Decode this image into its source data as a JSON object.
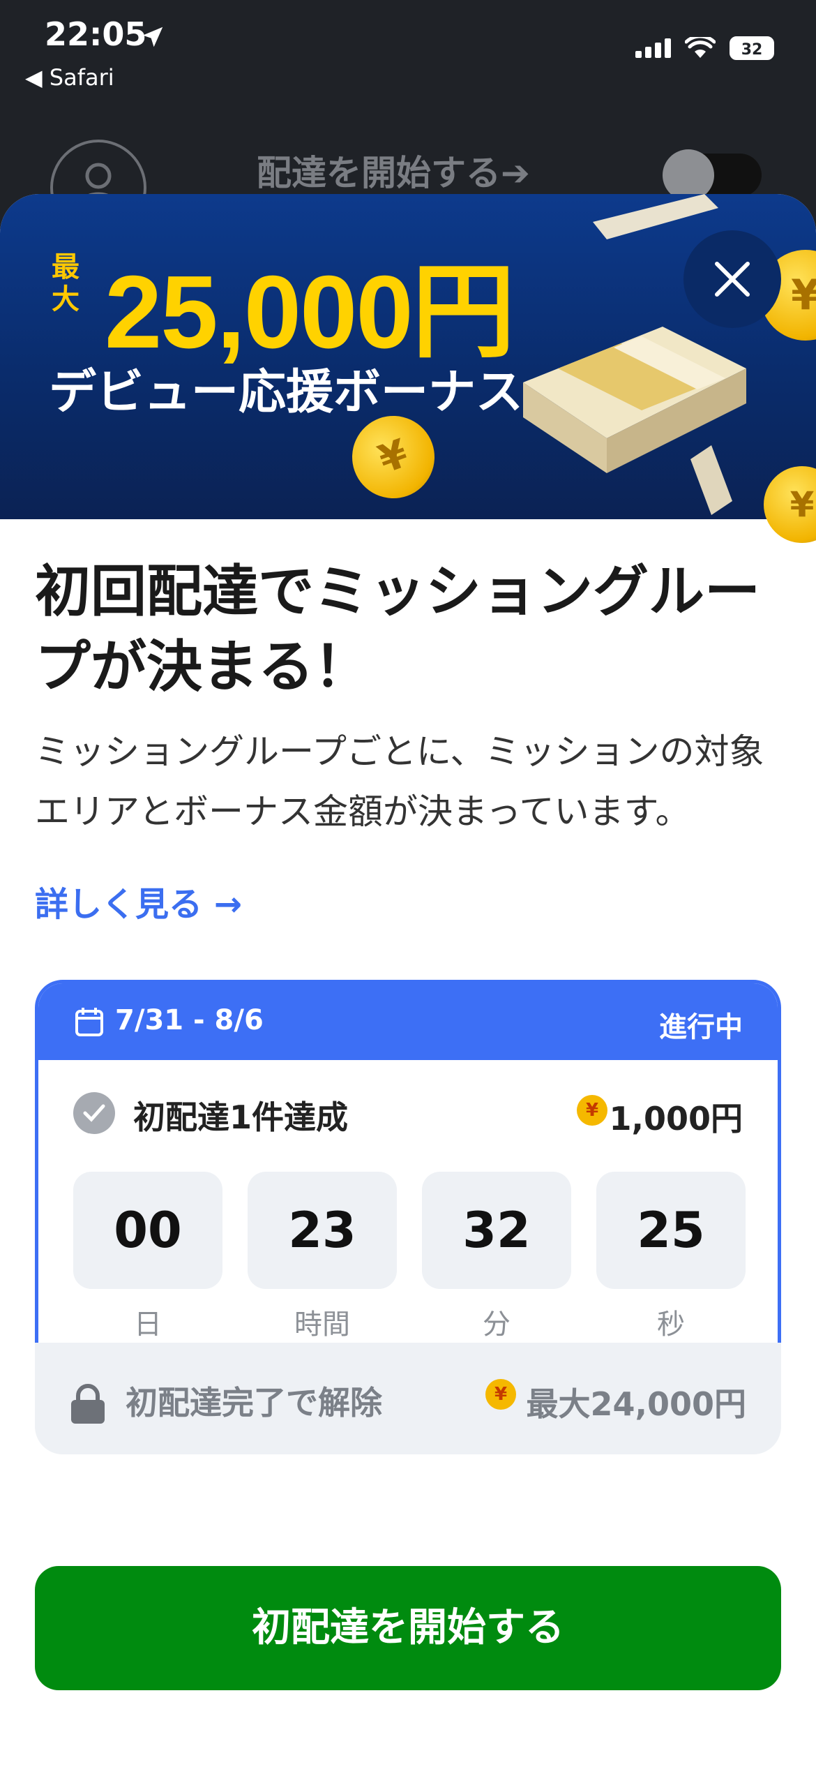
{
  "status_bar": {
    "time": "22:05",
    "back_label": "◀ Safari",
    "battery": "32"
  },
  "top_bar": {
    "title": "配達を開始する➔"
  },
  "banner": {
    "max_label": "最大",
    "amount": "25,000円",
    "subtitle": "デビュー応援ボーナス"
  },
  "content": {
    "heading": "初回配達でミッショングループが決まる！",
    "description": "ミッショングループごとに、ミッションの対象エリアとボーナス金額が決まっています。",
    "more_link": "詳しく見る →"
  },
  "mission_card": {
    "date_range": "7/31 - 8/6",
    "status": "進行中",
    "task": "初配達1件達成",
    "yen_symbol": "¥",
    "reward": "1,000円",
    "countdown": [
      {
        "value": "00",
        "unit": "日"
      },
      {
        "value": "23",
        "unit": "時間"
      },
      {
        "value": "32",
        "unit": "分"
      },
      {
        "value": "25",
        "unit": "秒"
      }
    ]
  },
  "locked_section": {
    "text": "初配達完了で解除",
    "yen_symbol": "¥",
    "amount": "最大24,000円"
  },
  "cta": {
    "label": "初配達を開始する"
  },
  "colors": {
    "accent": "#3d6ff5",
    "cta": "#008b0f",
    "banner": "#0d3a8c",
    "gold": "#ffd200"
  }
}
